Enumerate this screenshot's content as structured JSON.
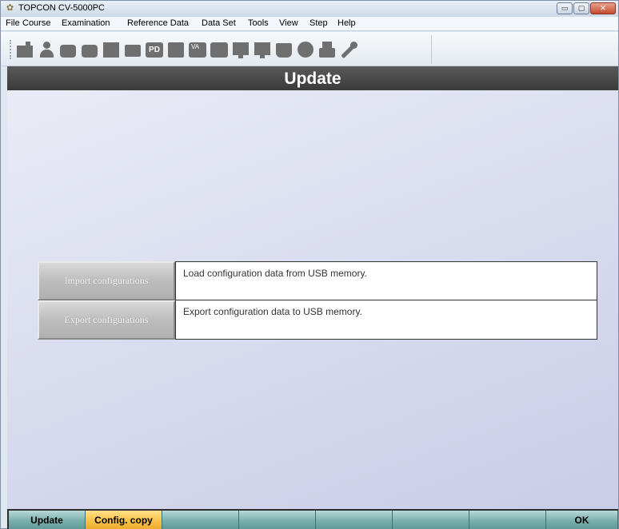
{
  "window": {
    "title": "TOPCON CV-5000PC",
    "controls": {
      "minimize": "▭",
      "maximize": "▢",
      "close": "✕"
    }
  },
  "menu": [
    {
      "label": "File",
      "name": "menu-file"
    },
    {
      "label": "Course",
      "name": "menu-course"
    },
    {
      "label": "Examination",
      "name": "menu-examination"
    },
    {
      "label": "Reference Data",
      "name": "menu-reference-data"
    },
    {
      "label": "Data Set",
      "name": "menu-data-set"
    },
    {
      "label": "Tools",
      "name": "menu-tools"
    },
    {
      "label": "View",
      "name": "menu-view"
    },
    {
      "label": "Step",
      "name": "menu-step"
    },
    {
      "label": "Help",
      "name": "menu-help"
    }
  ],
  "toolbar": {
    "pd_label": "PD",
    "va_label": "VA",
    "icons": [
      "device-icon",
      "patient-icon",
      "lensmeter-icon",
      "refractor-icon",
      "chart-panel-icon",
      "folder-icon",
      "pd-icon",
      "square-icon",
      "va-icon",
      "phoropter-icon",
      "display-icon",
      "monitor-icon",
      "book-icon",
      "circle-icon",
      "printer-icon",
      "wrench-icon"
    ]
  },
  "page": {
    "title": "Update"
  },
  "options": [
    {
      "button": "Import configurations",
      "description": "Load configuration data from USB memory."
    },
    {
      "button": "Export configurations",
      "description": "Export configuration data to USB memory."
    }
  ],
  "tabs": [
    {
      "label": "Update",
      "active": false
    },
    {
      "label": "Config. copy",
      "active": true
    },
    {
      "label": "",
      "active": false
    },
    {
      "label": "",
      "active": false
    },
    {
      "label": "",
      "active": false
    },
    {
      "label": "",
      "active": false
    },
    {
      "label": "",
      "active": false
    },
    {
      "label": "OK",
      "active": false
    }
  ],
  "colors": {
    "header_band": "#444444",
    "tab": "#77aeac",
    "tab_active": "#f8c048"
  }
}
